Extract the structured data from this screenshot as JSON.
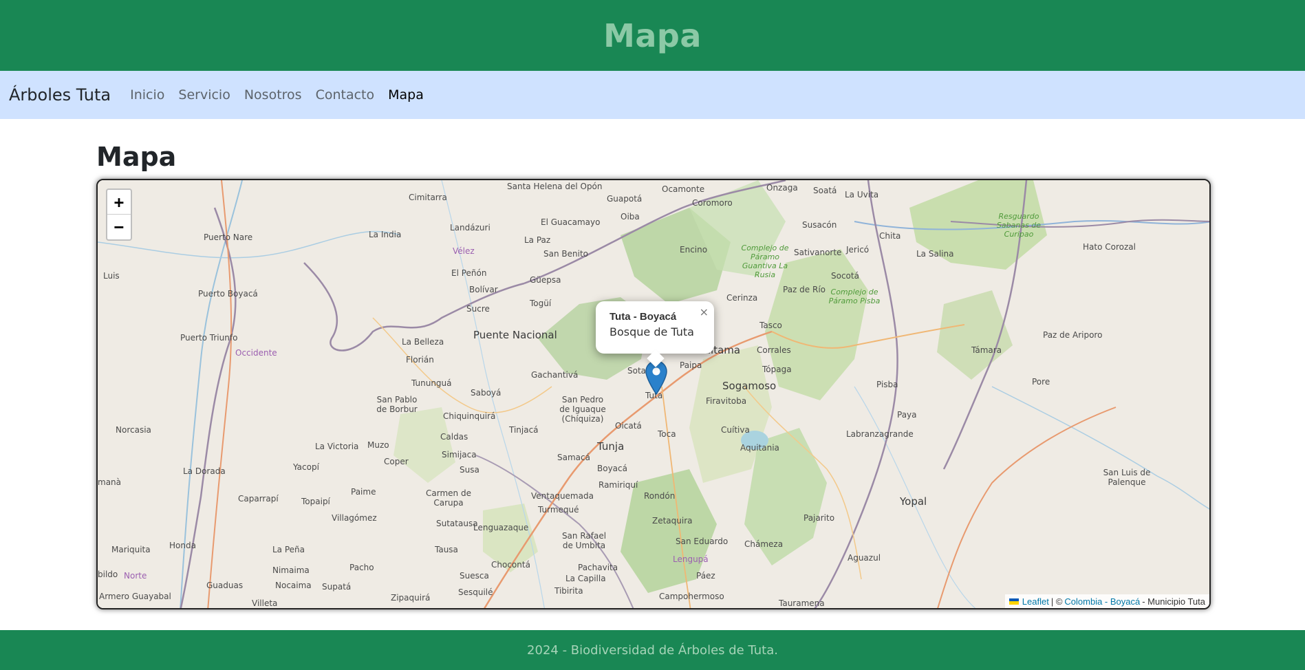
{
  "header": {
    "title": "Mapa"
  },
  "nav": {
    "brand": "Árboles Tuta",
    "links": [
      {
        "label": "Inicio",
        "active": false
      },
      {
        "label": "Servicio",
        "active": false
      },
      {
        "label": "Nosotros",
        "active": false
      },
      {
        "label": "Contacto",
        "active": false
      },
      {
        "label": "Mapa",
        "active": true
      }
    ]
  },
  "main": {
    "heading": "Mapa"
  },
  "map": {
    "zoom_in_label": "+",
    "zoom_out_label": "−",
    "popup": {
      "title": "Tuta - Boyacá",
      "body": "Bosque de Tuta",
      "close_label": "×"
    },
    "attribution": {
      "leaflet": "Leaflet",
      "separator": "| ©",
      "source": "Colombia - Boyacá",
      "suffix": "- Municipio Tuta"
    },
    "place_labels": [
      "Santa Helena del Opón",
      "Ocamonte",
      "Onzaga",
      "Soatá",
      "La Uvita",
      "Cimitarra",
      "Guapotá",
      "Coromoro",
      "Resguardo Sabanas de Curipao",
      "Landázuri",
      "El Guacamayo",
      "Oiba",
      "Susacón",
      "Puerto Nare",
      "La India",
      "La Paz",
      "Encino",
      "Chita",
      "Hato Corozal",
      "Vélez",
      "San Benito",
      "Complejo de Páramo Guantiva La Rusia",
      "Sativanorte",
      "Jericó",
      "La Salina",
      "Luis",
      "El Peñón",
      "Güepsa",
      "Socotá",
      "Puerto Boyacá",
      "Bolívar",
      "Paz de Río",
      "Complejo de Páramo Pisba",
      "Sucre",
      "Togüí",
      "Cerinza",
      "Puerto Triunfo",
      "La Belleza",
      "Puente Nacional",
      "Tasco",
      "Paz de Ariporo",
      "Occidente",
      "Florián",
      "Duitama",
      "Corrales",
      "Támara",
      "Sotaquirá",
      "Paipa",
      "Gachantivá",
      "Tópaga",
      "Tununguá",
      "Sogamoso",
      "Pisba",
      "Pore",
      "Saboyá",
      "San Pablo de Borbur",
      "San Pedro de Iguaque (Chíquiza)",
      "Tuta",
      "Firavitoba",
      "Paya",
      "Chiquinquirá",
      "Norcasia",
      "Oicatá",
      "Tinjacá",
      "Caldas",
      "Toca",
      "Cuítiva",
      "Labranzagrande",
      "Muzo",
      "Aquitania",
      "Simijaca",
      "La Victoria",
      "Tunja",
      "Samacá",
      "Coper",
      "Yacopí",
      "Susa",
      "Boyacá",
      "San Luis de Palenque",
      "La Dorada",
      "Ramiriquí",
      "Paime",
      "Carmen de Carupa",
      "Ventaquemada",
      "Rondón",
      "Caparrapí",
      "Topaipí",
      "Yopal",
      "Villagómez",
      "Turmequé",
      "Sutatausa",
      "Lenguazaque",
      "Pajarito",
      "Zetaquira",
      "San Rafael de Umbita",
      "San Eduardo",
      "Chámeza",
      "Mariquita",
      "Honda",
      "La Peña",
      "Tausa",
      "Lengupá",
      "Pacho",
      "Chocontá",
      "Aguazul",
      "Pachavita",
      "Nimaima",
      "Páez",
      "Norte",
      "Suesca",
      "La Capilla",
      "Guaduas",
      "Nocaima",
      "Supatá",
      "Sesquilé",
      "Tibirita",
      "Armero Guayabal",
      "Zipaquirá",
      "Campohermoso",
      "Villeta",
      "Tauramena",
      "bildo",
      "manà"
    ]
  }
}
